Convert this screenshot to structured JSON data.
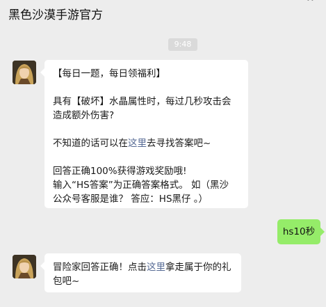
{
  "header": {
    "title": "黑色沙漠手游官方",
    "more_label": "··"
  },
  "chat": {
    "timestamp": "9:48",
    "message1": {
      "line1": "【每日一题，每日领福利】",
      "line2a": "具有【破坏】水晶属性时，每过几秒攻击会",
      "line2b": "造成额外伤害?",
      "line3_pre": "不知道的话可以在",
      "line3_link": "这里",
      "line3_post": "去寻找答案吧~",
      "line4": "回答正确100%获得游戏奖励哦!",
      "line5": "输入“HS答案”为正确答案格式。 如（黑沙",
      "line6": "公众号客服是谁？ 答应：HS黑仔 。）"
    },
    "reply": {
      "text": "hs10秒"
    },
    "message2": {
      "pre": "冒险家回答正确！点击",
      "link": "这里",
      "post": "拿走属于你的礼",
      "line2": "包吧~"
    }
  },
  "colors": {
    "background": "#ededed",
    "bubble_self": "#95ec69",
    "link": "#576b95"
  }
}
